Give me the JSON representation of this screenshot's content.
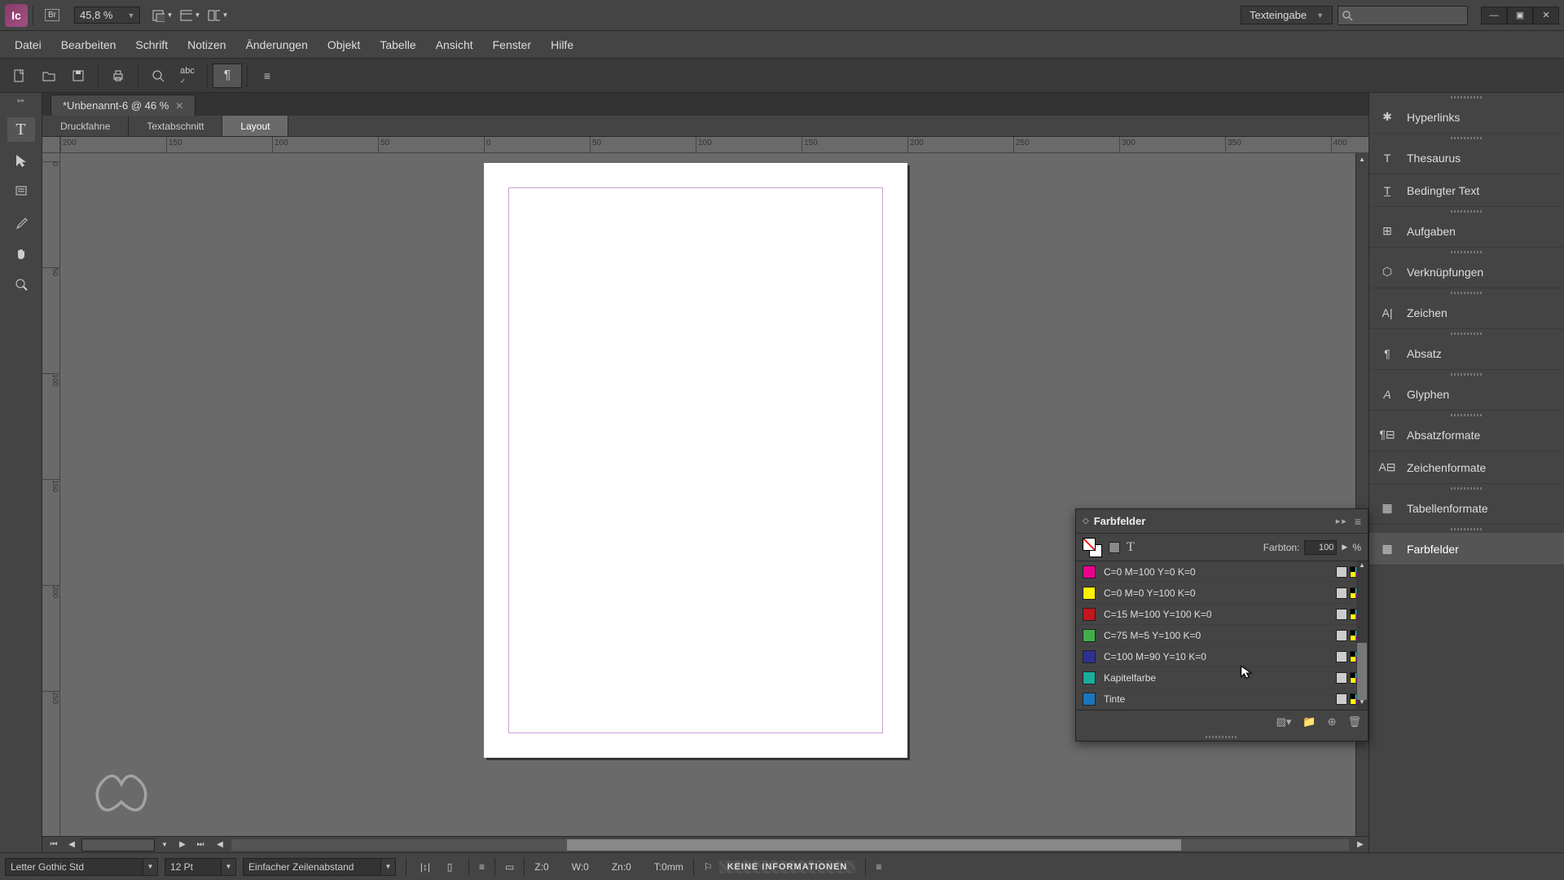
{
  "app": {
    "icon_label": "Ic",
    "workspace": "Texteingabe",
    "zoom_display": "45,8 %"
  },
  "menus": [
    "Datei",
    "Bearbeiten",
    "Schrift",
    "Notizen",
    "Änderungen",
    "Objekt",
    "Tabelle",
    "Ansicht",
    "Fenster",
    "Hilfe"
  ],
  "doc": {
    "tab_label": "*Unbenannt-6 @ 46 %"
  },
  "view_tabs": [
    "Druckfahne",
    "Textabschnitt",
    "Layout"
  ],
  "ruler_h": [
    "200",
    "150",
    "100",
    "50",
    "0",
    "50",
    "100",
    "150",
    "200",
    "250",
    "300",
    "350",
    "400"
  ],
  "ruler_v": [
    "0",
    "50",
    "100",
    "150",
    "200",
    "250"
  ],
  "right_panels": [
    "Hyperlinks",
    "Thesaurus",
    "Bedingter Text",
    "Aufgaben",
    "Verknüpfungen",
    "Zeichen",
    "Absatz",
    "Glyphen",
    "Absatzformate",
    "Zeichenformate",
    "Tabellenformate",
    "Farbfelder"
  ],
  "swatches": {
    "title": "Farbfelder",
    "tint_label": "Farbton:",
    "tint_value": "100",
    "tint_unit": "%",
    "items": [
      {
        "name": "C=0 M=100 Y=0 K=0",
        "color": "#ec008c"
      },
      {
        "name": "C=0 M=0 Y=100 K=0",
        "color": "#fff200"
      },
      {
        "name": "C=15 M=100 Y=100 K=0",
        "color": "#c4161c"
      },
      {
        "name": "C=75 M=5 Y=100 K=0",
        "color": "#3fae49"
      },
      {
        "name": "C=100 M=90 Y=10 K=0",
        "color": "#2e3192"
      },
      {
        "name": "Kapitelfarbe",
        "color": "#1aae9a"
      },
      {
        "name": "Tinte",
        "color": "#1c75bc"
      }
    ]
  },
  "status": {
    "font": "Letter Gothic Std",
    "size": "12 Pt",
    "leading": "Einfacher Zeilenabstand",
    "z": "Z:0",
    "w": "W:0",
    "zn": "Zn:0",
    "t": "T:0mm",
    "info": "KEINE INFORMATIONEN"
  }
}
